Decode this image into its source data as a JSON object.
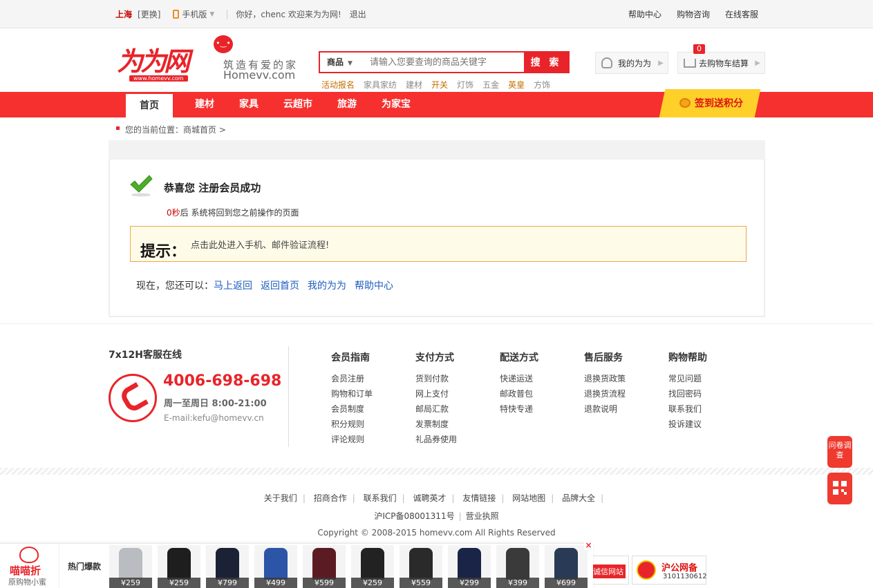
{
  "topbar": {
    "city": "上海",
    "change": "[更换]",
    "mobile": "手机版",
    "welcome": "你好，chenc 欢迎来为为网!",
    "logout": "退出",
    "right": [
      "帮助中心",
      "购物咨询",
      "在线客服"
    ]
  },
  "header": {
    "logo": "为为网",
    "logo_url": "www.homevv.com",
    "slogan": "筑造有爱的家",
    "slogan_en": "Homevv.com",
    "search_category": "商品",
    "search_placeholder": "请输入您要查询的商品关键字",
    "search_button": "搜 索",
    "hotwords": [
      "活动报名",
      "家具家纺",
      "建材",
      "开关",
      "灯饰",
      "五金",
      "英皇",
      "方饰"
    ],
    "my_account": "我的为为",
    "cart_label": "去购物车结算",
    "cart_count": "0"
  },
  "nav": {
    "items": [
      "首页",
      "建材",
      "家具",
      "云超市",
      "旅游",
      "为家宝"
    ],
    "signin": "签到送积分"
  },
  "breadcrumb": "您的当前位置：商城首页 >",
  "main": {
    "title": "恭喜您 注册会员成功",
    "countdown_sec": "0秒",
    "countdown_text": "后 系统将回到您之前操作的页面",
    "tip_label": "提示：",
    "tip_text": "点击此处进入手机、邮件验证流程!",
    "links_prefix": "现在，您还可以：",
    "links": [
      "马上返回",
      "返回首页",
      "我的为为",
      "帮助中心"
    ]
  },
  "footer": {
    "cs_title": "7x12H客服在线",
    "hotline": "4006-698-698",
    "hours": "周一至周日 8:00-21:00",
    "email": "E-mail:kefu@homevv.cn",
    "columns": [
      {
        "title": "会员指南",
        "items": [
          "会员注册",
          "购物和订单",
          "会员制度",
          "积分规则",
          "评论规则"
        ]
      },
      {
        "title": "支付方式",
        "items": [
          "货到付款",
          "网上支付",
          "邮局汇款",
          "发票制度",
          "礼品券使用"
        ]
      },
      {
        "title": "配送方式",
        "items": [
          "快递运送",
          "邮政普包",
          "特快专递"
        ]
      },
      {
        "title": "售后服务",
        "items": [
          "退换货政策",
          "退换货流程",
          "退款说明"
        ]
      },
      {
        "title": "购物帮助",
        "items": [
          "常见问题",
          "找回密码",
          "联系我们",
          "投诉建议"
        ]
      }
    ],
    "bottom_links": [
      "关于我们",
      "招商合作",
      "联系我们",
      "诚聘英才",
      "友情链接",
      "网站地图",
      "品牌大全"
    ],
    "icp": "沪ICP备08001311号",
    "license": "营业执照",
    "copyright": "Copyright © 2008-2015 homevv.com All Rights Reserved",
    "badge_credit": "诚信网站",
    "badge_police": "沪公网备",
    "badge_police_no": "3101130612"
  },
  "side": {
    "survey": "问卷调查",
    "qr_icon": "qrcode-icon"
  },
  "bottombar": {
    "brand": "喵喵折",
    "brand_sub": "原购物小蜜",
    "hot_label": "热门爆款",
    "products": [
      {
        "price": "¥259",
        "color": "#b9bcc0"
      },
      {
        "price": "¥259",
        "color": "#1e1e1e"
      },
      {
        "price": "¥799",
        "color": "#1c2236"
      },
      {
        "price": "¥499",
        "color": "#2c55a8"
      },
      {
        "price": "¥599",
        "color": "#5a1c22"
      },
      {
        "price": "¥259",
        "color": "#222222"
      },
      {
        "price": "¥559",
        "color": "#2a2a2a"
      },
      {
        "price": "¥299",
        "color": "#1a2446"
      },
      {
        "price": "¥399",
        "color": "#3a3a3a"
      },
      {
        "price": "¥699",
        "color": "#283a55"
      }
    ],
    "close": "×"
  }
}
